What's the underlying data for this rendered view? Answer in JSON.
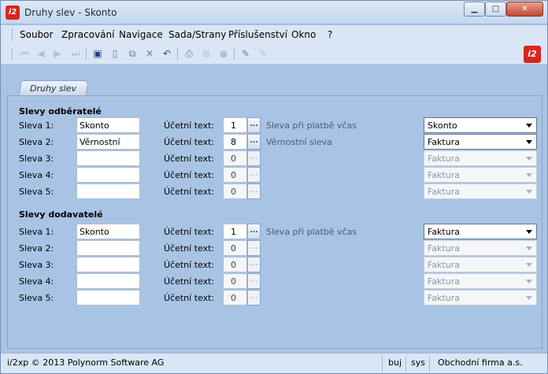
{
  "window": {
    "title": "Druhy slev - Skonto",
    "app_icon": "i2"
  },
  "menu": [
    "Soubor",
    "Zpracování",
    "Navigace",
    "Sada/Strany",
    "Příslušenství",
    "Okno",
    "?"
  ],
  "toolbar": {
    "icons": [
      "first-record-icon",
      "prev-record-icon",
      "next-record-icon",
      "last-record-icon",
      "save-icon",
      "new-icon",
      "copy-icon",
      "delete-icon",
      "undo-icon",
      "print-icon",
      "tree-icon",
      "circle-icon",
      "edit-icon",
      "clear-icon"
    ],
    "logo": "i2"
  },
  "tab": {
    "label": "Druhy slev"
  },
  "sections": [
    {
      "title": "Slevy odběratelé",
      "rows": [
        {
          "label": "Sleva 1:",
          "name": "Skonto",
          "text_label": "Účetní text:",
          "code": "1",
          "desc": "Sleva při platbě včas",
          "type": "Skonto",
          "enabled": true
        },
        {
          "label": "Sleva 2:",
          "name": "Věrnostní",
          "text_label": "Účetní text:",
          "code": "8",
          "desc": "Věrnostní sleva",
          "type": "Faktura",
          "enabled": true
        },
        {
          "label": "Sleva 3:",
          "name": "",
          "text_label": "Účetní text:",
          "code": "0",
          "desc": "",
          "type": "Faktura",
          "enabled": false
        },
        {
          "label": "Sleva 4:",
          "name": "",
          "text_label": "Účetní text:",
          "code": "0",
          "desc": "",
          "type": "Faktura",
          "enabled": false
        },
        {
          "label": "Sleva 5:",
          "name": "",
          "text_label": "Účetní text:",
          "code": "0",
          "desc": "",
          "type": "Faktura",
          "enabled": false
        }
      ]
    },
    {
      "title": "Slevy dodavatelé",
      "rows": [
        {
          "label": "Sleva 1:",
          "name": "Skonto",
          "text_label": "Účetní text:",
          "code": "1",
          "desc": "Sleva při platbě včas",
          "type": "Faktura",
          "enabled": true
        },
        {
          "label": "Sleva 2:",
          "name": "",
          "text_label": "Účetní text:",
          "code": "0",
          "desc": "",
          "type": "Faktura",
          "enabled": false
        },
        {
          "label": "Sleva 3:",
          "name": "",
          "text_label": "Účetní text:",
          "code": "0",
          "desc": "",
          "type": "Faktura",
          "enabled": false
        },
        {
          "label": "Sleva 4:",
          "name": "",
          "text_label": "Účetní text:",
          "code": "0",
          "desc": "",
          "type": "Faktura",
          "enabled": false
        },
        {
          "label": "Sleva 5:",
          "name": "",
          "text_label": "Účetní text:",
          "code": "0",
          "desc": "",
          "type": "Faktura",
          "enabled": false
        }
      ]
    }
  ],
  "lookup_button": "...",
  "status": {
    "copyright": "i/2xp © 2013 Polynorm Software AG",
    "user": "buj",
    "db": "sys",
    "company": "Obchodní firma a.s."
  },
  "colors": {
    "accent": "#d8251f",
    "background": "#a9c3e4"
  }
}
